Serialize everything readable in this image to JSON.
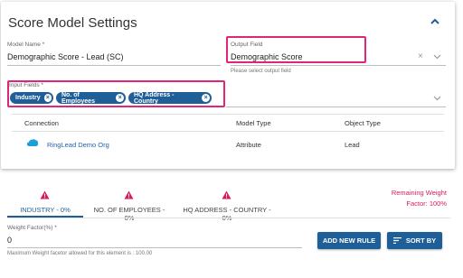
{
  "header": {
    "title": "Score Model Settings"
  },
  "model_name": {
    "label": "Model Name *",
    "value": "Demographic Score - Lead (SC)"
  },
  "output_field": {
    "label": "Output Field",
    "value": "Demographic Score",
    "hint": "Please select output field"
  },
  "input_fields": {
    "label": "Input Fields *",
    "chips": [
      {
        "label": "Industry"
      },
      {
        "label": "No. of Employees"
      },
      {
        "label": "HQ Address - Country"
      }
    ]
  },
  "table": {
    "headers": {
      "connection": "Connection",
      "model_type": "Model Type",
      "object_type": "Object Type"
    },
    "row": {
      "connection": "RingLead Demo Org",
      "model_type": "Attribute",
      "object_type": "Lead"
    }
  },
  "remaining": {
    "line1": "Remaining Weight",
    "line2": "Factor: 100%"
  },
  "tabs": [
    {
      "label": "INDUSTRY - 0%"
    },
    {
      "label": "NO. OF EMPLOYEES - 0%"
    },
    {
      "label": "HQ ADDRESS - COUNTRY - 0%"
    }
  ],
  "weight": {
    "label": "Weight Factor(%) *",
    "value": "0",
    "hint": "Maximum Weight facetor allowed for this element is : 100.00"
  },
  "buttons": {
    "add_rule": "ADD NEW RULE",
    "sort_by": "SORT BY"
  },
  "colors": {
    "accent": "#1f5f99",
    "highlight": "#e0267b",
    "warning": "#d81b60",
    "link": "#1e63b0"
  }
}
